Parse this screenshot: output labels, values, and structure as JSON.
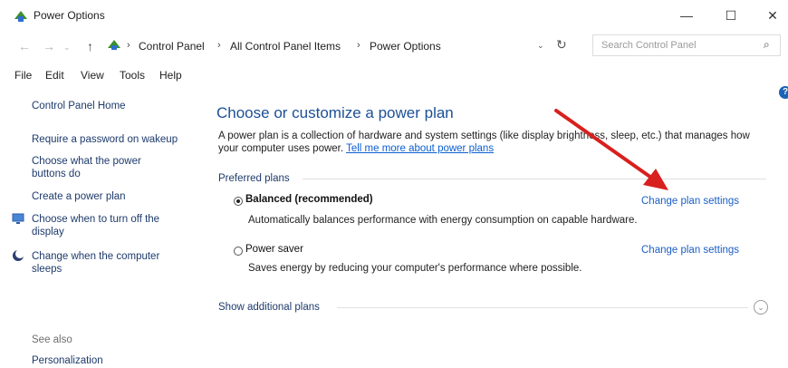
{
  "window": {
    "title": "Power Options"
  },
  "address": {
    "crumbs": [
      "Control Panel",
      "All Control Panel Items",
      "Power Options"
    ],
    "search_placeholder": "Search Control Panel"
  },
  "menu": [
    "File",
    "Edit",
    "View",
    "Tools",
    "Help"
  ],
  "sidebar": {
    "home": "Control Panel Home",
    "links": [
      "Require a password on wakeup",
      "Choose what the power buttons do",
      "Create a power plan",
      "Choose when to turn off the display",
      "Change when the computer sleeps"
    ],
    "see_also": "See also",
    "personalization": "Personalization"
  },
  "main": {
    "heading": "Choose or customize a power plan",
    "description": "A power plan is a collection of hardware and system settings (like display brightness, sleep, etc.) that manages how your computer uses power.",
    "learn_link": "Tell me more about power plans",
    "preferred_label": "Preferred plans",
    "plans": [
      {
        "name": "Balanced (recommended)",
        "desc": "Automatically balances performance with energy consumption on capable hardware.",
        "link": "Change plan settings",
        "selected": true
      },
      {
        "name": "Power saver",
        "desc": "Saves energy by reducing your computer's performance where possible.",
        "link": "Change plan settings",
        "selected": false
      }
    ],
    "additional_label": "Show additional plans"
  },
  "colors": {
    "heading": "#1c4f96",
    "link": "#1a5fc5",
    "annotation_arrow": "#d8201e"
  }
}
